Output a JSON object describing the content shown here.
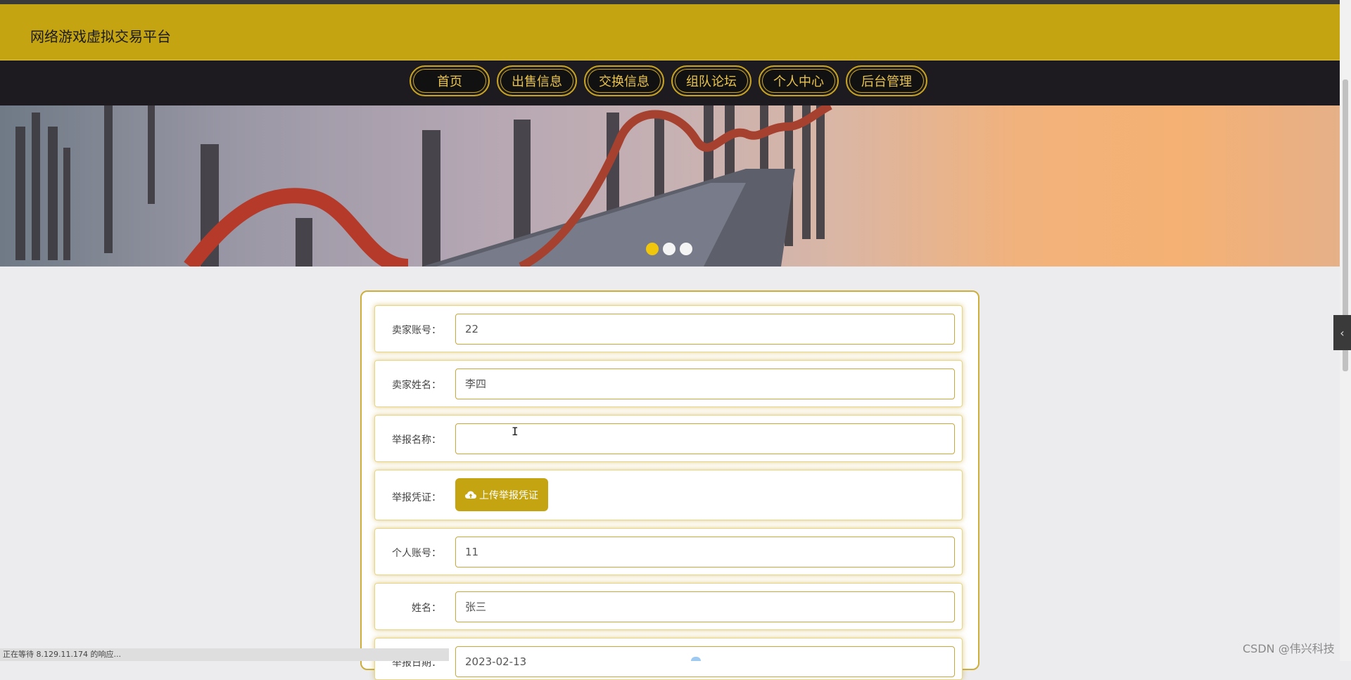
{
  "header": {
    "title": "网络游戏虚拟交易平台",
    "bg_color": "#c4a411"
  },
  "nav": {
    "items": [
      {
        "label": "首页"
      },
      {
        "label": "出售信息"
      },
      {
        "label": "交换信息"
      },
      {
        "label": "组队论坛"
      },
      {
        "label": "个人中心"
      },
      {
        "label": "后台管理"
      }
    ]
  },
  "carousel": {
    "dots": 3,
    "active_index": 0
  },
  "form": {
    "seller_account": {
      "label": "卖家账号：",
      "value": "22"
    },
    "seller_name": {
      "label": "卖家姓名：",
      "value": "李四"
    },
    "report_name": {
      "label": "举报名称：",
      "value": ""
    },
    "report_proof": {
      "label": "举报凭证：",
      "button": "上传举报凭证",
      "button_icon": "cloud-upload-icon"
    },
    "personal_account": {
      "label": "个人账号：",
      "value": "11"
    },
    "name": {
      "label": "姓名：",
      "value": "张三"
    },
    "report_date": {
      "label": "举报日期：",
      "value": "2023-02-13"
    }
  },
  "status_bar": {
    "text": "正在等待 8.129.11.174 的响应..."
  },
  "watermark": {
    "text": "CSDN @伟兴科技"
  }
}
